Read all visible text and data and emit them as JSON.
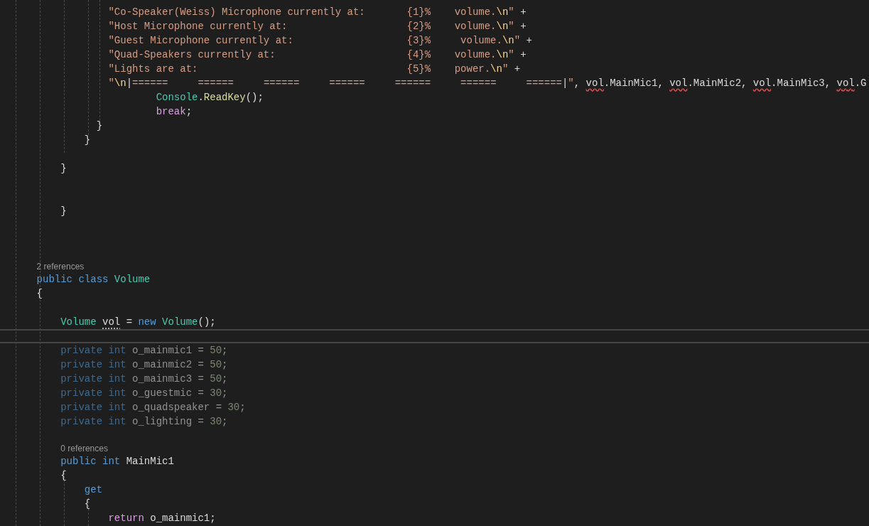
{
  "editor": {
    "lines": [
      {
        "kind": "code",
        "current": false,
        "faded": false,
        "tokens": [
          {
            "text": "                \"Co-Speaker(Weiss) Microphone currently at:       {1}%    volume.",
            "kind": "string"
          },
          {
            "text": "\\n",
            "kind": "escape"
          },
          {
            "text": "\"",
            "kind": "string"
          },
          {
            "text": " +",
            "kind": "plain"
          }
        ]
      },
      {
        "kind": "code",
        "current": false,
        "faded": false,
        "tokens": [
          {
            "text": "                \"Host Microphone currently at:                    {2}%    volume.",
            "kind": "string"
          },
          {
            "text": "\\n",
            "kind": "escape"
          },
          {
            "text": "\"",
            "kind": "string"
          },
          {
            "text": " +",
            "kind": "plain"
          }
        ]
      },
      {
        "kind": "code",
        "current": false,
        "faded": false,
        "tokens": [
          {
            "text": "                \"Guest Microphone currently at:                   {3}%     volume.",
            "kind": "string"
          },
          {
            "text": "\\n",
            "kind": "escape"
          },
          {
            "text": "\"",
            "kind": "string"
          },
          {
            "text": " +",
            "kind": "plain"
          }
        ]
      },
      {
        "kind": "code",
        "current": false,
        "faded": false,
        "tokens": [
          {
            "text": "                \"Quad-Speakers currently at:                      {4}%    volume.",
            "kind": "string"
          },
          {
            "text": "\\n",
            "kind": "escape"
          },
          {
            "text": "\"",
            "kind": "string"
          },
          {
            "text": " +",
            "kind": "plain"
          }
        ]
      },
      {
        "kind": "code",
        "current": false,
        "faded": false,
        "tokens": [
          {
            "text": "                \"Lights are at:                                   {5}%    power.",
            "kind": "string"
          },
          {
            "text": "\\n",
            "kind": "escape"
          },
          {
            "text": "\"",
            "kind": "string"
          },
          {
            "text": " +",
            "kind": "plain"
          }
        ]
      },
      {
        "kind": "code",
        "current": false,
        "faded": false,
        "tokens": [
          {
            "text": "                \"",
            "kind": "string"
          },
          {
            "text": "\\n",
            "kind": "escape"
          },
          {
            "text": "|",
            "kind": "plain"
          },
          {
            "text": "======     ======     ======     ======     ======     ======     ======",
            "kind": "string"
          },
          {
            "text": "|",
            "kind": "plain"
          },
          {
            "text": "\"",
            "kind": "string"
          },
          {
            "text": ", ",
            "kind": "plain"
          },
          {
            "text": "vol",
            "kind": "error"
          },
          {
            "text": ".MainMic1, ",
            "kind": "plain"
          },
          {
            "text": "vol",
            "kind": "error"
          },
          {
            "text": ".MainMic2, ",
            "kind": "plain"
          },
          {
            "text": "vol",
            "kind": "error"
          },
          {
            "text": ".MainMic3, ",
            "kind": "plain"
          },
          {
            "text": "vol",
            "kind": "error"
          },
          {
            "text": ".G",
            "kind": "plain"
          }
        ]
      },
      {
        "kind": "code",
        "current": false,
        "faded": false,
        "tokens": [
          {
            "text": "                        Console",
            "kind": "type"
          },
          {
            "text": ".",
            "kind": "plain"
          },
          {
            "text": "ReadKey",
            "kind": "method"
          },
          {
            "text": "();",
            "kind": "plain"
          }
        ]
      },
      {
        "kind": "code",
        "current": false,
        "faded": false,
        "tokens": [
          {
            "text": "                        break",
            "kind": "control"
          },
          {
            "text": ";",
            "kind": "plain"
          }
        ]
      },
      {
        "kind": "code",
        "current": false,
        "faded": false,
        "tokens": [
          {
            "text": "              }",
            "kind": "plain"
          }
        ]
      },
      {
        "kind": "code",
        "current": false,
        "faded": false,
        "tokens": [
          {
            "text": "            }",
            "kind": "plain"
          }
        ]
      },
      {
        "kind": "blank",
        "current": false
      },
      {
        "kind": "code",
        "current": false,
        "faded": false,
        "tokens": [
          {
            "text": "        }",
            "kind": "plain"
          }
        ]
      },
      {
        "kind": "blank",
        "current": false
      },
      {
        "kind": "blank",
        "current": false
      },
      {
        "kind": "code",
        "current": false,
        "faded": false,
        "tokens": [
          {
            "text": "        }",
            "kind": "plain"
          }
        ]
      },
      {
        "kind": "blank",
        "current": false
      },
      {
        "kind": "blank",
        "current": false
      },
      {
        "kind": "blank",
        "current": false
      },
      {
        "kind": "codelens",
        "current": false,
        "tokens": [
          {
            "text": "    2 references"
          }
        ]
      },
      {
        "kind": "code",
        "current": false,
        "faded": false,
        "tokens": [
          {
            "text": "    public",
            "kind": "keyword"
          },
          {
            "text": " class",
            "kind": "keyword"
          },
          {
            "text": " Volume",
            "kind": "type"
          }
        ]
      },
      {
        "kind": "code",
        "current": false,
        "faded": false,
        "tokens": [
          {
            "text": "    {",
            "kind": "plain"
          }
        ]
      },
      {
        "kind": "blank",
        "current": false
      },
      {
        "kind": "code",
        "current": false,
        "faded": false,
        "tokens": [
          {
            "text": "        Volume ",
            "kind": "type"
          },
          {
            "text": "vol",
            "kind": "hint"
          },
          {
            "text": " = ",
            "kind": "plain"
          },
          {
            "text": "new",
            "kind": "keyword"
          },
          {
            "text": " Volume",
            "kind": "type"
          },
          {
            "text": "();",
            "kind": "plain"
          }
        ]
      },
      {
        "kind": "blank",
        "current": true
      },
      {
        "kind": "code",
        "current": false,
        "faded": true,
        "tokens": [
          {
            "text": "        private",
            "kind": "keyword"
          },
          {
            "text": " int",
            "kind": "keyword"
          },
          {
            "text": " o_mainmic1 = ",
            "kind": "plain"
          },
          {
            "text": "50",
            "kind": "number"
          },
          {
            "text": ";",
            "kind": "plain"
          }
        ]
      },
      {
        "kind": "code",
        "current": false,
        "faded": true,
        "tokens": [
          {
            "text": "        private",
            "kind": "keyword"
          },
          {
            "text": " int",
            "kind": "keyword"
          },
          {
            "text": " o_mainmic2 = ",
            "kind": "plain"
          },
          {
            "text": "50",
            "kind": "number"
          },
          {
            "text": ";",
            "kind": "plain"
          }
        ]
      },
      {
        "kind": "code",
        "current": false,
        "faded": true,
        "tokens": [
          {
            "text": "        private",
            "kind": "keyword"
          },
          {
            "text": " int",
            "kind": "keyword"
          },
          {
            "text": " o_mainmic3 = ",
            "kind": "plain"
          },
          {
            "text": "50",
            "kind": "number"
          },
          {
            "text": ";",
            "kind": "plain"
          }
        ]
      },
      {
        "kind": "code",
        "current": false,
        "faded": true,
        "tokens": [
          {
            "text": "        private",
            "kind": "keyword"
          },
          {
            "text": " int",
            "kind": "keyword"
          },
          {
            "text": " o_guestmic = ",
            "kind": "plain"
          },
          {
            "text": "30",
            "kind": "number"
          },
          {
            "text": ";",
            "kind": "plain"
          }
        ]
      },
      {
        "kind": "code",
        "current": false,
        "faded": true,
        "tokens": [
          {
            "text": "        private",
            "kind": "keyword"
          },
          {
            "text": " int",
            "kind": "keyword"
          },
          {
            "text": " o_quadspeaker = ",
            "kind": "plain"
          },
          {
            "text": "30",
            "kind": "number"
          },
          {
            "text": ";",
            "kind": "plain"
          }
        ]
      },
      {
        "kind": "code",
        "current": false,
        "faded": true,
        "tokens": [
          {
            "text": "        private",
            "kind": "keyword"
          },
          {
            "text": " int",
            "kind": "keyword"
          },
          {
            "text": " o_lighting = ",
            "kind": "plain"
          },
          {
            "text": "30",
            "kind": "number"
          },
          {
            "text": ";",
            "kind": "plain"
          }
        ]
      },
      {
        "kind": "blank",
        "current": false
      },
      {
        "kind": "codelens",
        "current": false,
        "tokens": [
          {
            "text": "        0 references"
          }
        ]
      },
      {
        "kind": "code",
        "current": false,
        "faded": false,
        "tokens": [
          {
            "text": "        public",
            "kind": "keyword"
          },
          {
            "text": " int",
            "kind": "keyword"
          },
          {
            "text": " MainMic1",
            "kind": "plain"
          }
        ]
      },
      {
        "kind": "code",
        "current": false,
        "faded": false,
        "tokens": [
          {
            "text": "        {",
            "kind": "plain"
          }
        ]
      },
      {
        "kind": "code",
        "current": false,
        "faded": false,
        "tokens": [
          {
            "text": "            get",
            "kind": "keyword"
          }
        ]
      },
      {
        "kind": "code",
        "current": false,
        "faded": false,
        "tokens": [
          {
            "text": "            {",
            "kind": "plain"
          }
        ]
      },
      {
        "kind": "code",
        "current": false,
        "faded": false,
        "tokens": [
          {
            "text": "                return",
            "kind": "control"
          },
          {
            "text": " o_mainmic1;",
            "kind": "plain"
          }
        ]
      }
    ]
  }
}
